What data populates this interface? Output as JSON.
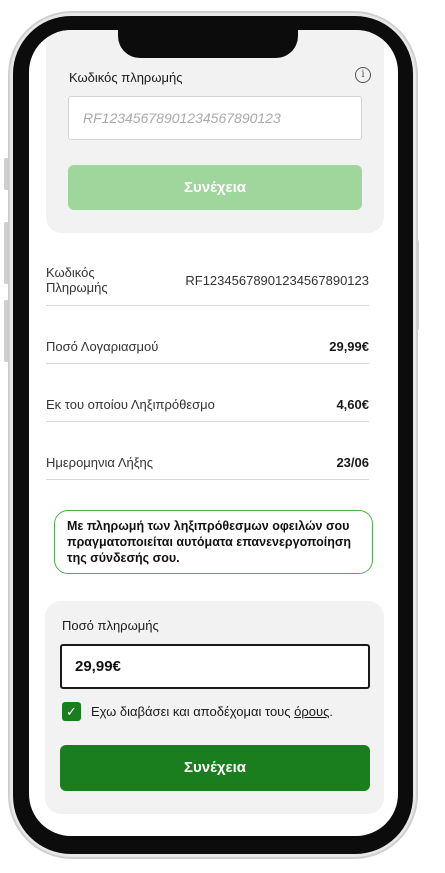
{
  "payment_code_card": {
    "label": "Κωδικός πληρωμής",
    "info_icon": "i",
    "input_placeholder": "RF12345678901234567890123",
    "continue_label": "Συνέχεια",
    "continue_color": "#9fd69b"
  },
  "details": [
    {
      "key": "Κωδικός\nΠληρωμής",
      "value": "RF12345678901234567890123",
      "bold": false
    },
    {
      "key": "Ποσό Λογαριασμού",
      "value": "29,99€",
      "bold": true
    },
    {
      "key": "Εκ του οποίου Ληξιπρόθεσμο",
      "value": "4,60€",
      "bold": true
    },
    {
      "key": "Ημερομηνια Λήξης",
      "value": "23/06",
      "bold": true
    }
  ],
  "notice_text": "Με πληρωμή των ληξιπρόθεσμων οφειλών σου πραγματοποιείται αυτόματα επανενεργοποίηση της σύνδεσής σου.",
  "payment_amount_card": {
    "label": "Ποσό πληρωμής",
    "amount_value": "29,99€",
    "terms_prefix": "Εχω διαβάσει και αποδέχομαι τους ",
    "terms_link": "όρους",
    "terms_suffix": ".",
    "terms_checked": true,
    "continue_label": "Συνέχεια",
    "continue_color": "#1b7e1e"
  },
  "colors": {
    "accent_green": "#1b7e1e",
    "light_green": "#9fd69b",
    "notice_border": "#4fae4f"
  }
}
